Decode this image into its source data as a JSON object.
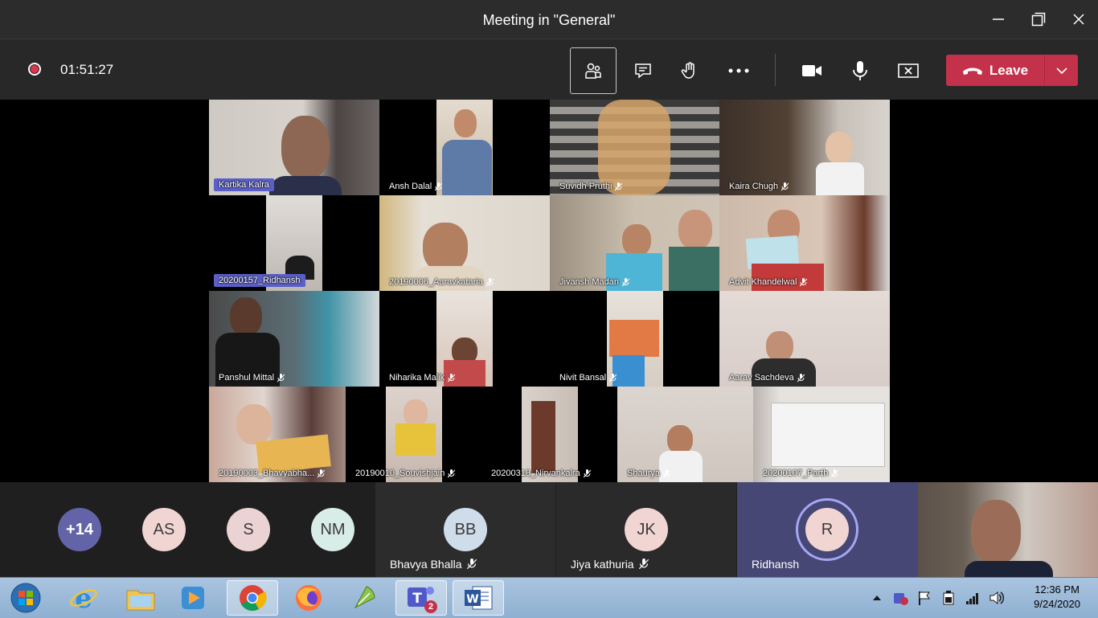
{
  "window": {
    "title": "Meeting in \"General\""
  },
  "toolbar": {
    "timer": "01:51:27",
    "leave_label": "Leave"
  },
  "grid": {
    "tiles": [
      {
        "name": "Kartika  Kalra",
        "muted": false,
        "highlight": true
      },
      {
        "name": "Ansh Dalal",
        "muted": true
      },
      {
        "name": "Suvidh Pruthi",
        "muted": true
      },
      {
        "name": "Kaira Chugh",
        "muted": true
      },
      {
        "name": "20200157_Ridhansh",
        "muted": false,
        "highlight": true
      },
      {
        "name": "20190006_Aaravkataria",
        "muted": true
      },
      {
        "name": "Jivansh Madan",
        "muted": true
      },
      {
        "name": "Advit Khandelwal",
        "muted": true
      },
      {
        "name": "Panshul Mittal",
        "muted": true
      },
      {
        "name": "Niharika Malik",
        "muted": true
      },
      {
        "name": "Nivit Bansal",
        "muted": true
      },
      {
        "name": "Aarav Sachdeva",
        "muted": true
      },
      {
        "name": "20190003_Bhavyabha...",
        "muted": true
      },
      {
        "name": "20190010_Souvishjain",
        "muted": true
      },
      {
        "name": "20200318_Nirvankalra",
        "muted": true
      },
      {
        "name": "Shaurya",
        "muted": true
      },
      {
        "name": "20200107_Parth",
        "muted": true
      }
    ]
  },
  "bottom": {
    "avatars": [
      {
        "initials": "+14",
        "color": "#6264a7"
      },
      {
        "initials": "AS",
        "color": "#f1d5d2"
      },
      {
        "initials": "S",
        "color": "#ecd3d3"
      },
      {
        "initials": "NM",
        "color": "#d8ece8"
      }
    ],
    "participants": [
      {
        "initials": "BB",
        "name": "Bhavya Bhalla",
        "color": "#cfdcea"
      },
      {
        "initials": "JK",
        "name": "Jiya kathuria",
        "color": "#f1d5d2"
      },
      {
        "initials": "R",
        "name": "Ridhansh",
        "color": "#f1d5d2"
      }
    ]
  },
  "taskbar": {
    "time": "12:36 PM",
    "date": "9/24/2020",
    "teams_badge": "2"
  }
}
